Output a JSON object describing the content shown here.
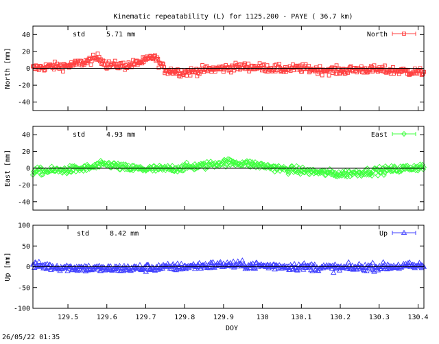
{
  "title": "Kinematic repeatability (L) for 1125.200 - PAYE  ( 36.7 km)",
  "timestamp": "26/05/22 01:35",
  "chart_data": [
    {
      "type": "scatter",
      "series": [
        {
          "name": "North",
          "color": "#ff4040"
        }
      ],
      "ylabel": "North [mm]",
      "ylim": [
        -50,
        50
      ],
      "yticks": [
        40,
        20,
        0,
        -20,
        -40
      ],
      "xlim": [
        129.41,
        130.415
      ],
      "std_label": "std",
      "std_value": "5.71 mm",
      "profile": [
        [
          129.41,
          0
        ],
        [
          129.45,
          2
        ],
        [
          129.5,
          3
        ],
        [
          129.55,
          8
        ],
        [
          129.58,
          13
        ],
        [
          129.6,
          4
        ],
        [
          129.65,
          3
        ],
        [
          129.7,
          9
        ],
        [
          129.72,
          14
        ],
        [
          129.75,
          -2
        ],
        [
          129.8,
          -5
        ],
        [
          129.85,
          -2
        ],
        [
          129.9,
          0
        ],
        [
          129.95,
          2
        ],
        [
          130.0,
          1
        ],
        [
          130.05,
          -1
        ],
        [
          130.1,
          0
        ],
        [
          130.15,
          -2
        ],
        [
          130.2,
          -3
        ],
        [
          130.25,
          -1
        ],
        [
          130.3,
          -2
        ],
        [
          130.35,
          -3
        ],
        [
          130.415,
          -5
        ]
      ],
      "noise": 3.5
    },
    {
      "type": "scatter",
      "series": [
        {
          "name": "East",
          "color": "#40ff40"
        }
      ],
      "ylabel": "East [mm]",
      "ylim": [
        -50,
        50
      ],
      "yticks": [
        40,
        20,
        0,
        -20,
        -40
      ],
      "xlim": [
        129.41,
        130.415
      ],
      "std_label": "std",
      "std_value": "4.93 mm",
      "profile": [
        [
          129.41,
          -4
        ],
        [
          129.45,
          -3
        ],
        [
          129.5,
          -2
        ],
        [
          129.55,
          0
        ],
        [
          129.6,
          5
        ],
        [
          129.65,
          0
        ],
        [
          129.7,
          -1
        ],
        [
          129.75,
          -1
        ],
        [
          129.8,
          1
        ],
        [
          129.85,
          3
        ],
        [
          129.9,
          7
        ],
        [
          129.95,
          6
        ],
        [
          130.0,
          3
        ],
        [
          130.05,
          -1
        ],
        [
          130.1,
          -3
        ],
        [
          130.15,
          -5
        ],
        [
          130.2,
          -7
        ],
        [
          130.25,
          -5
        ],
        [
          130.3,
          -3
        ],
        [
          130.35,
          -1
        ],
        [
          130.415,
          2
        ]
      ],
      "noise": 3.2
    },
    {
      "type": "scatter",
      "series": [
        {
          "name": "Up",
          "color": "#4040ff"
        }
      ],
      "ylabel": "Up [mm]",
      "xlabel": "DOY",
      "ylim": [
        -100,
        100
      ],
      "yticks": [
        100,
        50,
        0,
        -50,
        -100
      ],
      "xlim": [
        129.41,
        130.415
      ],
      "xticks": [
        129.5,
        129.6,
        129.7,
        129.8,
        129.9,
        130,
        130.1,
        130.2,
        130.3,
        130.4
      ],
      "std_label": "std",
      "std_value": "8.42 mm",
      "profile": [
        [
          129.41,
          3
        ],
        [
          129.5,
          -2
        ],
        [
          129.6,
          -5
        ],
        [
          129.7,
          -3
        ],
        [
          129.8,
          0
        ],
        [
          129.9,
          5
        ],
        [
          130.0,
          2
        ],
        [
          130.1,
          0
        ],
        [
          130.2,
          -3
        ],
        [
          130.3,
          0
        ],
        [
          130.415,
          2
        ]
      ],
      "noise": 6.5
    }
  ]
}
